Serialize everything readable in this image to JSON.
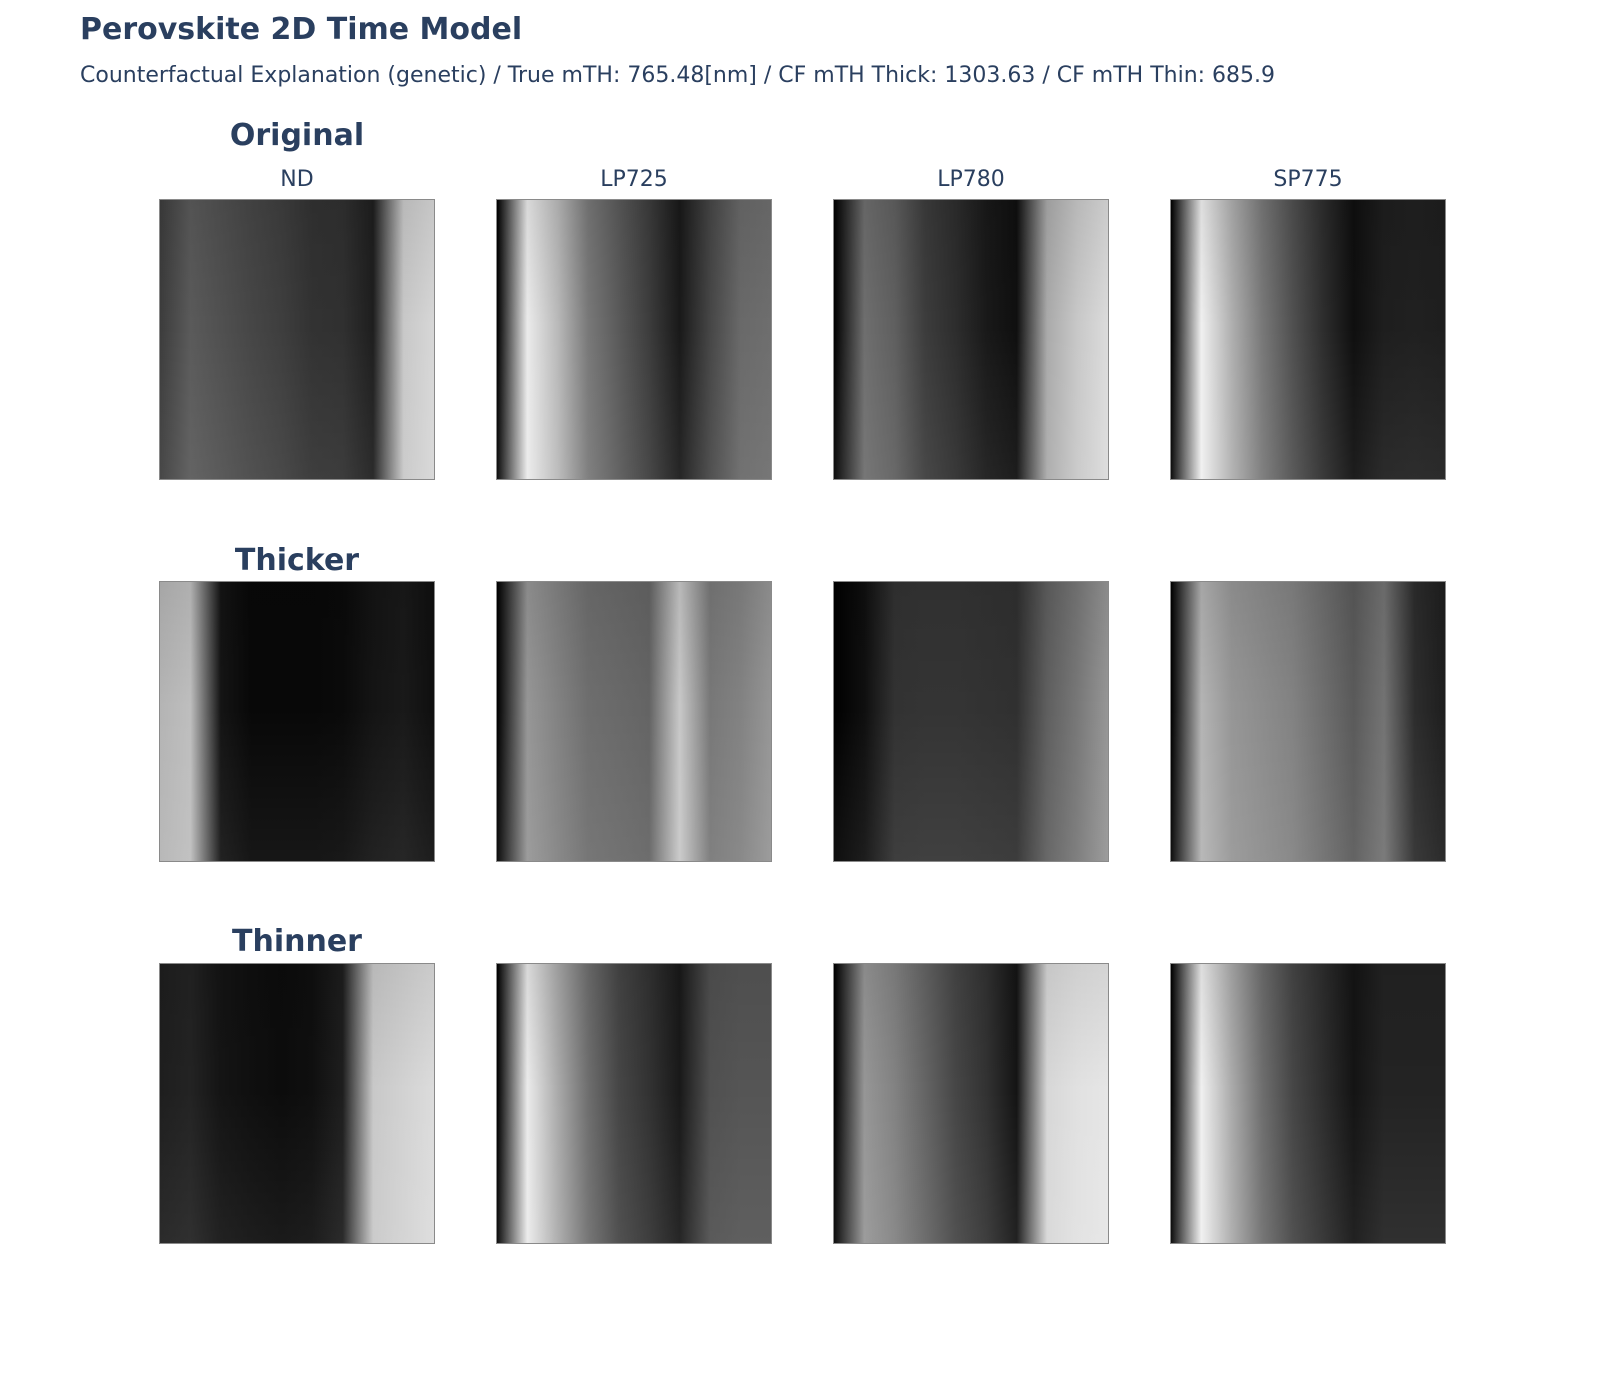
{
  "title": "Perovskite 2D Time Model",
  "subtitle": "Counterfactual Explanation (genetic) / True mTH: 765.48[nm] / CF mTH Thick: 1303.63 / CF mTH Thin: 685.9",
  "chart_data": {
    "type": "heatmap",
    "colorscale": "grayscale",
    "columns": [
      "ND",
      "LP725",
      "LP780",
      "SP775"
    ],
    "rows": [
      {
        "label": "Original",
        "panels": [
          {
            "channel": "ND",
            "intensity": [
              60,
              90,
              80,
              70,
              62,
              50,
              48,
              30,
              200,
              215
            ]
          },
          {
            "channel": "LP725",
            "intensity": [
              0,
              235,
              185,
              120,
              90,
              60,
              25,
              70,
              105,
              110
            ]
          },
          {
            "channel": "LP780",
            "intensity": [
              0,
              110,
              95,
              60,
              45,
              25,
              15,
              170,
              200,
              220
            ]
          },
          {
            "channel": "SP775",
            "intensity": [
              0,
              240,
              175,
              120,
              80,
              45,
              15,
              30,
              32,
              30
            ]
          }
        ]
      },
      {
        "label": "Thicker",
        "panels": [
          {
            "channel": "ND",
            "intensity": [
              180,
              190,
              20,
              8,
              8,
              8,
              10,
              20,
              25,
              15
            ]
          },
          {
            "channel": "LP725",
            "intensity": [
              0,
              150,
              130,
              110,
              105,
              100,
              200,
              120,
              130,
              150
            ]
          },
          {
            "channel": "LP780",
            "intensity": [
              0,
              15,
              50,
              52,
              52,
              50,
              48,
              95,
              120,
              150
            ]
          },
          {
            "channel": "SP775",
            "intensity": [
              0,
              180,
              150,
              140,
              130,
              110,
              90,
              115,
              45,
              30
            ]
          }
        ]
      },
      {
        "label": "Thinner",
        "panels": [
          {
            "channel": "ND",
            "intensity": [
              30,
              35,
              20,
              15,
              12,
              15,
              30,
              200,
              210,
              220
            ]
          },
          {
            "channel": "LP725",
            "intensity": [
              0,
              235,
              170,
              110,
              70,
              50,
              25,
              80,
              85,
              85
            ]
          },
          {
            "channel": "LP780",
            "intensity": [
              0,
              150,
              130,
              100,
              70,
              50,
              20,
              215,
              225,
              230
            ]
          },
          {
            "channel": "SP775",
            "intensity": [
              0,
              240,
              170,
              110,
              70,
              45,
              20,
              35,
              35,
              35
            ]
          }
        ]
      }
    ]
  }
}
